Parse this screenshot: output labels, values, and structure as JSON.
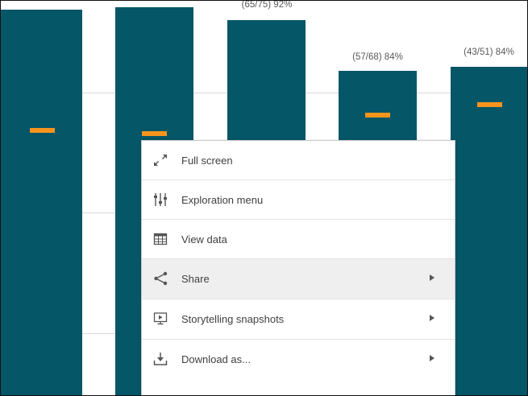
{
  "chart_data": {
    "type": "bar",
    "bars": [
      {
        "label": ""
      },
      {
        "label": ""
      },
      {
        "label": "(65/75) 92%"
      },
      {
        "label": "(57/68) 84%"
      },
      {
        "label": "(43/51) 84%"
      }
    ],
    "bar_color": "#055667",
    "target_marker_color": "#f7941d",
    "grid": true
  },
  "context_menu": {
    "items": [
      {
        "label": "Full screen",
        "icon": "expand-icon",
        "has_submenu": false
      },
      {
        "label": "Exploration menu",
        "icon": "sliders-icon",
        "has_submenu": false
      },
      {
        "label": "View data",
        "icon": "table-icon",
        "has_submenu": false
      },
      {
        "label": "Share",
        "icon": "share-icon",
        "has_submenu": true
      },
      {
        "label": "Storytelling snapshots",
        "icon": "presentation-icon",
        "has_submenu": true
      },
      {
        "label": "Download as...",
        "icon": "download-icon",
        "has_submenu": true
      }
    ]
  }
}
